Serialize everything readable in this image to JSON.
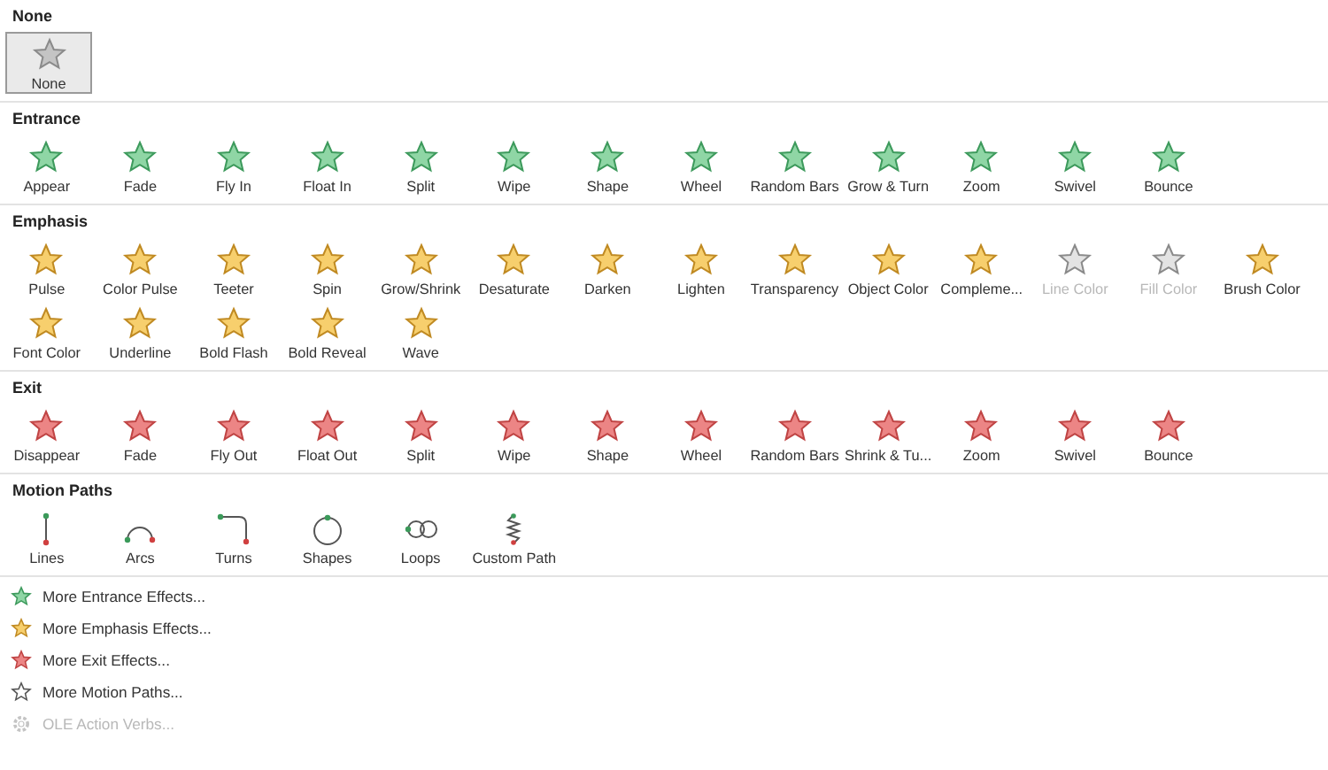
{
  "sections": [
    {
      "title": "None",
      "kind": "none",
      "items": [
        {
          "label": "None",
          "selected": true,
          "disabled": false
        }
      ]
    },
    {
      "title": "Entrance",
      "kind": "entrance",
      "items": [
        {
          "label": "Appear",
          "selected": false,
          "disabled": false
        },
        {
          "label": "Fade",
          "selected": false,
          "disabled": false
        },
        {
          "label": "Fly In",
          "selected": false,
          "disabled": false
        },
        {
          "label": "Float In",
          "selected": false,
          "disabled": false
        },
        {
          "label": "Split",
          "selected": false,
          "disabled": false
        },
        {
          "label": "Wipe",
          "selected": false,
          "disabled": false
        },
        {
          "label": "Shape",
          "selected": false,
          "disabled": false
        },
        {
          "label": "Wheel",
          "selected": false,
          "disabled": false
        },
        {
          "label": "Random Bars",
          "selected": false,
          "disabled": false
        },
        {
          "label": "Grow & Turn",
          "selected": false,
          "disabled": false
        },
        {
          "label": "Zoom",
          "selected": false,
          "disabled": false
        },
        {
          "label": "Swivel",
          "selected": false,
          "disabled": false
        },
        {
          "label": "Bounce",
          "selected": false,
          "disabled": false
        }
      ]
    },
    {
      "title": "Emphasis",
      "kind": "emphasis",
      "items": [
        {
          "label": "Pulse",
          "selected": false,
          "disabled": false
        },
        {
          "label": "Color Pulse",
          "selected": false,
          "disabled": false
        },
        {
          "label": "Teeter",
          "selected": false,
          "disabled": false
        },
        {
          "label": "Spin",
          "selected": false,
          "disabled": false
        },
        {
          "label": "Grow/Shrink",
          "selected": false,
          "disabled": false
        },
        {
          "label": "Desaturate",
          "selected": false,
          "disabled": false
        },
        {
          "label": "Darken",
          "selected": false,
          "disabled": false
        },
        {
          "label": "Lighten",
          "selected": false,
          "disabled": false
        },
        {
          "label": "Transparency",
          "selected": false,
          "disabled": false
        },
        {
          "label": "Object Color",
          "selected": false,
          "disabled": false
        },
        {
          "label": "Compleme...",
          "selected": false,
          "disabled": false
        },
        {
          "label": "Line Color",
          "selected": false,
          "disabled": true
        },
        {
          "label": "Fill Color",
          "selected": false,
          "disabled": true
        },
        {
          "label": "Brush Color",
          "selected": false,
          "disabled": false
        },
        {
          "label": "Font Color",
          "selected": false,
          "disabled": false
        },
        {
          "label": "Underline",
          "selected": false,
          "disabled": false
        },
        {
          "label": "Bold Flash",
          "selected": false,
          "disabled": false
        },
        {
          "label": "Bold Reveal",
          "selected": false,
          "disabled": false
        },
        {
          "label": "Wave",
          "selected": false,
          "disabled": false
        }
      ]
    },
    {
      "title": "Exit",
      "kind": "exit",
      "items": [
        {
          "label": "Disappear",
          "selected": false,
          "disabled": false
        },
        {
          "label": "Fade",
          "selected": false,
          "disabled": false
        },
        {
          "label": "Fly Out",
          "selected": false,
          "disabled": false
        },
        {
          "label": "Float Out",
          "selected": false,
          "disabled": false
        },
        {
          "label": "Split",
          "selected": false,
          "disabled": false
        },
        {
          "label": "Wipe",
          "selected": false,
          "disabled": false
        },
        {
          "label": "Shape",
          "selected": false,
          "disabled": false
        },
        {
          "label": "Wheel",
          "selected": false,
          "disabled": false
        },
        {
          "label": "Random Bars",
          "selected": false,
          "disabled": false
        },
        {
          "label": "Shrink & Tu...",
          "selected": false,
          "disabled": false
        },
        {
          "label": "Zoom",
          "selected": false,
          "disabled": false
        },
        {
          "label": "Swivel",
          "selected": false,
          "disabled": false
        },
        {
          "label": "Bounce",
          "selected": false,
          "disabled": false
        }
      ]
    },
    {
      "title": "Motion Paths",
      "kind": "motion",
      "items": [
        {
          "label": "Lines",
          "kind": "line",
          "selected": false,
          "disabled": false
        },
        {
          "label": "Arcs",
          "kind": "arc",
          "selected": false,
          "disabled": false
        },
        {
          "label": "Turns",
          "kind": "turn",
          "selected": false,
          "disabled": false
        },
        {
          "label": "Shapes",
          "kind": "circle",
          "selected": false,
          "disabled": false
        },
        {
          "label": "Loops",
          "kind": "loop",
          "selected": false,
          "disabled": false
        },
        {
          "label": "Custom Path",
          "kind": "custom",
          "selected": false,
          "disabled": false
        }
      ]
    }
  ],
  "menu": [
    {
      "label": "More Entrance Effects...",
      "kind": "entrance",
      "disabled": false
    },
    {
      "label": "More Emphasis Effects...",
      "kind": "emphasis",
      "disabled": false
    },
    {
      "label": "More Exit Effects...",
      "kind": "exit",
      "disabled": false
    },
    {
      "label": "More Motion Paths...",
      "kind": "motion",
      "disabled": false
    },
    {
      "label": "OLE Action Verbs...",
      "kind": "ole",
      "disabled": true
    }
  ]
}
